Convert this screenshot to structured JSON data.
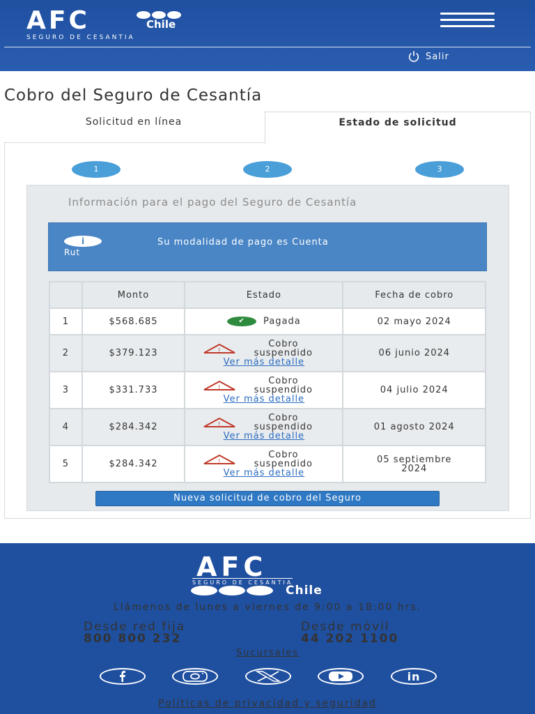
{
  "header": {
    "logo_text": "AFC",
    "logo_chile": "Chile",
    "logo_subtitle": "SEGURO DE CESANTIA",
    "menu_icon": "hamburger-icon",
    "logout_icon": "power-icon",
    "logout_label": "Salir"
  },
  "page": {
    "title": "Cobro del Seguro de Cesantía"
  },
  "tabs": [
    {
      "label": "Solicitud en línea"
    },
    {
      "label": "Estado de solicitud",
      "active": true
    }
  ],
  "steps": [
    "1",
    "2",
    "3"
  ],
  "info": {
    "title": "Información para el pago del Seguro de Cesantía",
    "alert_icon": "info-icon",
    "alert_icon_glyph": "i",
    "alert_rut": "Rut",
    "alert_text": "Su modalidad de pago es Cuenta"
  },
  "table": {
    "headers": [
      "",
      "Monto",
      "Estado",
      "Fecha de cobro"
    ],
    "rows": [
      {
        "num": "1",
        "monto": "$568.685",
        "estado": "Pagada",
        "status_icon": "check-icon",
        "detalle": "",
        "fecha": "02 mayo 2024"
      },
      {
        "num": "2",
        "monto": "$379.123",
        "estado": "Cobro suspendido",
        "status_icon": "warning-icon",
        "detalle": "Ver más detalle",
        "fecha": "06 junio 2024"
      },
      {
        "num": "3",
        "monto": "$331.733",
        "estado": "Cobro suspendido",
        "status_icon": "warning-icon",
        "detalle": "Ver más detalle",
        "fecha": "04 julio 2024"
      },
      {
        "num": "4",
        "monto": "$284.342",
        "estado": "Cobro suspendido",
        "status_icon": "warning-icon",
        "detalle": "Ver más detalle",
        "fecha": "01 agosto 2024"
      },
      {
        "num": "5",
        "monto": "$284.342",
        "estado": "Cobro suspendido",
        "status_icon": "warning-icon",
        "detalle": "Ver más detalle",
        "fecha": "05 septiembre 2024"
      }
    ]
  },
  "new_request_button": "Nueva solicitud de cobro del Seguro",
  "footer": {
    "logo_text": "AFC",
    "logo_subtitle": "SEGURO DE CESANTIA",
    "logo_chile": "Chile",
    "hours": "Llámenos de lunes a viernes de 9:00 a 18:00 hrs.",
    "fixed_label": "Desde red fija",
    "fixed_number": "800 800 232",
    "mobile_label": "Desde móvil",
    "mobile_number": "44 202 1100",
    "branches_link": "Sucursales",
    "social": [
      "facebook-icon",
      "instagram-icon",
      "x-icon",
      "youtube-icon",
      "linkedin-icon"
    ],
    "privacy_link": "Políticas de privacidad y seguridad"
  },
  "colors": {
    "brand_blue": "#1f4f9f",
    "step_blue": "#4a9fd8",
    "alert_blue": "#4a86c6",
    "button_blue": "#2f78c4",
    "success_green": "#2e8b3e",
    "warning_red": "#c0392b",
    "link_blue": "#2a6cc0"
  }
}
